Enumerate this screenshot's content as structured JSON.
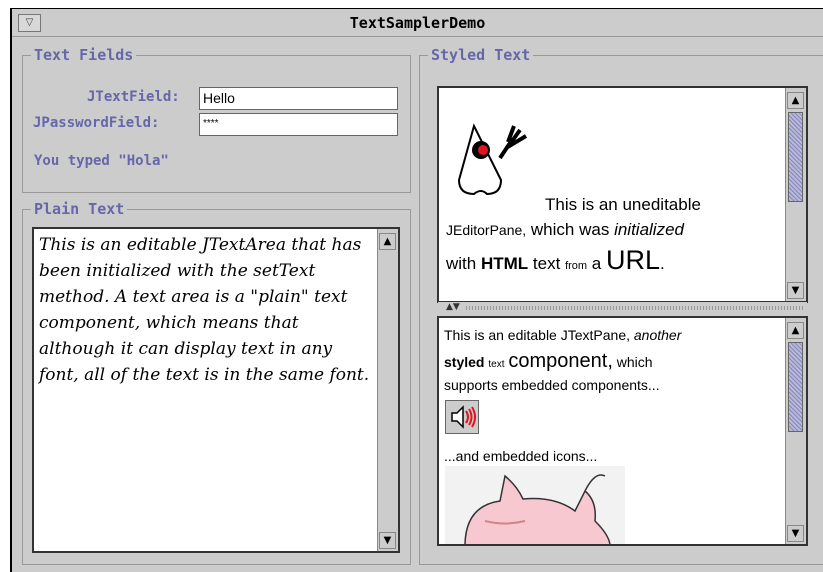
{
  "window": {
    "title": "TextSamplerDemo",
    "menu_glyph": "▽"
  },
  "text_fields": {
    "group_title": "Text Fields",
    "jtextfield_label": "JTextField:",
    "jtextfield_value": "Hello",
    "jpassword_label": "JPasswordField:",
    "jpassword_value": "****",
    "status": "You typed \"Hola\""
  },
  "plain_text": {
    "group_title": "Plain Text",
    "content": "This is an editable JTextArea that has been initialized with the setText method. A text area is a \"plain\" text component, which means that although it can display text in any font, all of the text is in the same font."
  },
  "styled_text": {
    "group_title": "Styled Text",
    "editor_pane": {
      "w1": "This is an uneditable",
      "w2": "JEditorPane,",
      "w3": "which was",
      "w4": "initialized",
      "w5": "with",
      "w6": "HTML",
      "w7": "text",
      "w8": "from",
      "w9": "a",
      "w10": "URL",
      "w11": "."
    },
    "text_pane": {
      "l1a": "This is an editable JTextPane,",
      "l1b": "another",
      "l2a": "styled",
      "l2b": "text",
      "l2c": "component,",
      "l2d": "which",
      "l3": "supports embedded components...",
      "l4": "...and embedded icons..."
    }
  },
  "colors": {
    "label": "#6666aa",
    "background": "#cccccc",
    "scroll_thumb": "#8888bb"
  }
}
